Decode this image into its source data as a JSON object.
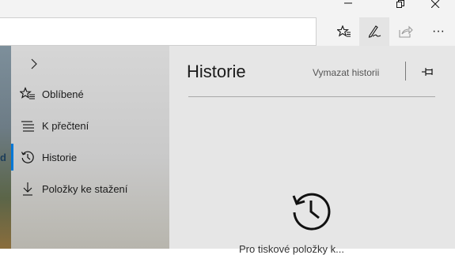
{
  "window": {
    "controls": [
      "minimize",
      "restore",
      "close"
    ]
  },
  "toolbar": {
    "address_value": "",
    "buttons": [
      "favorites-star-icon",
      "pen-notes-icon",
      "share-icon",
      "more-icon"
    ],
    "more_glyph": "···"
  },
  "page": {
    "partial_text": "d"
  },
  "hub": {
    "items": [
      {
        "label": "Oblíbené",
        "icon": "star-list-icon"
      },
      {
        "label": "K přečtení",
        "icon": "reading-list-icon"
      },
      {
        "label": "Historie",
        "icon": "history-icon",
        "selected": true
      },
      {
        "label": "Položky ke stažení",
        "icon": "download-icon"
      }
    ],
    "accent": "#0078d7"
  },
  "panel": {
    "title": "Historie",
    "clear_label": "Vymazat historii",
    "empty_message": "Pro tiskové položky k..."
  }
}
